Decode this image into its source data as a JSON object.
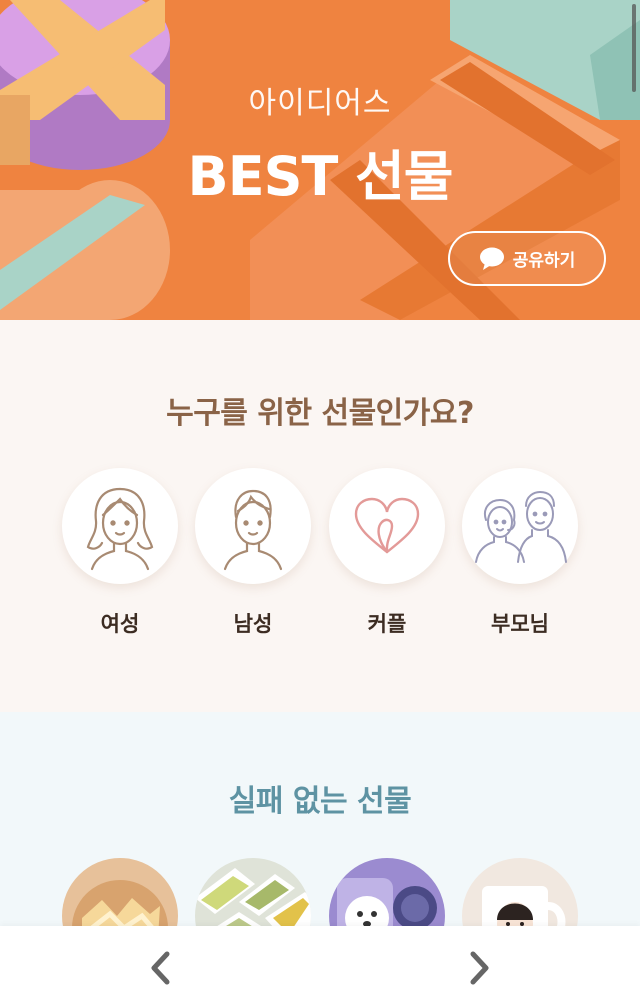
{
  "hero": {
    "subtitle": "아이디어스",
    "title": "BEST 선물",
    "share_label": "공유하기",
    "background_color": "#ef8340"
  },
  "who_section": {
    "title": "누구를 위한 선물인가요?",
    "recipients": [
      {
        "label": "여성",
        "icon": "woman-icon"
      },
      {
        "label": "남성",
        "icon": "man-icon"
      },
      {
        "label": "커플",
        "icon": "heart-icon"
      },
      {
        "label": "부모님",
        "icon": "parents-icon"
      }
    ]
  },
  "safe_section": {
    "title": "실패 없는 선물",
    "products": [
      {
        "icon": "snack-image"
      },
      {
        "icon": "side-dish-image"
      },
      {
        "icon": "dog-phone-case-image"
      },
      {
        "icon": "portrait-mug-image"
      }
    ]
  },
  "nav": {
    "prev_icon": "chevron-left-icon",
    "next_icon": "chevron-right-icon"
  }
}
